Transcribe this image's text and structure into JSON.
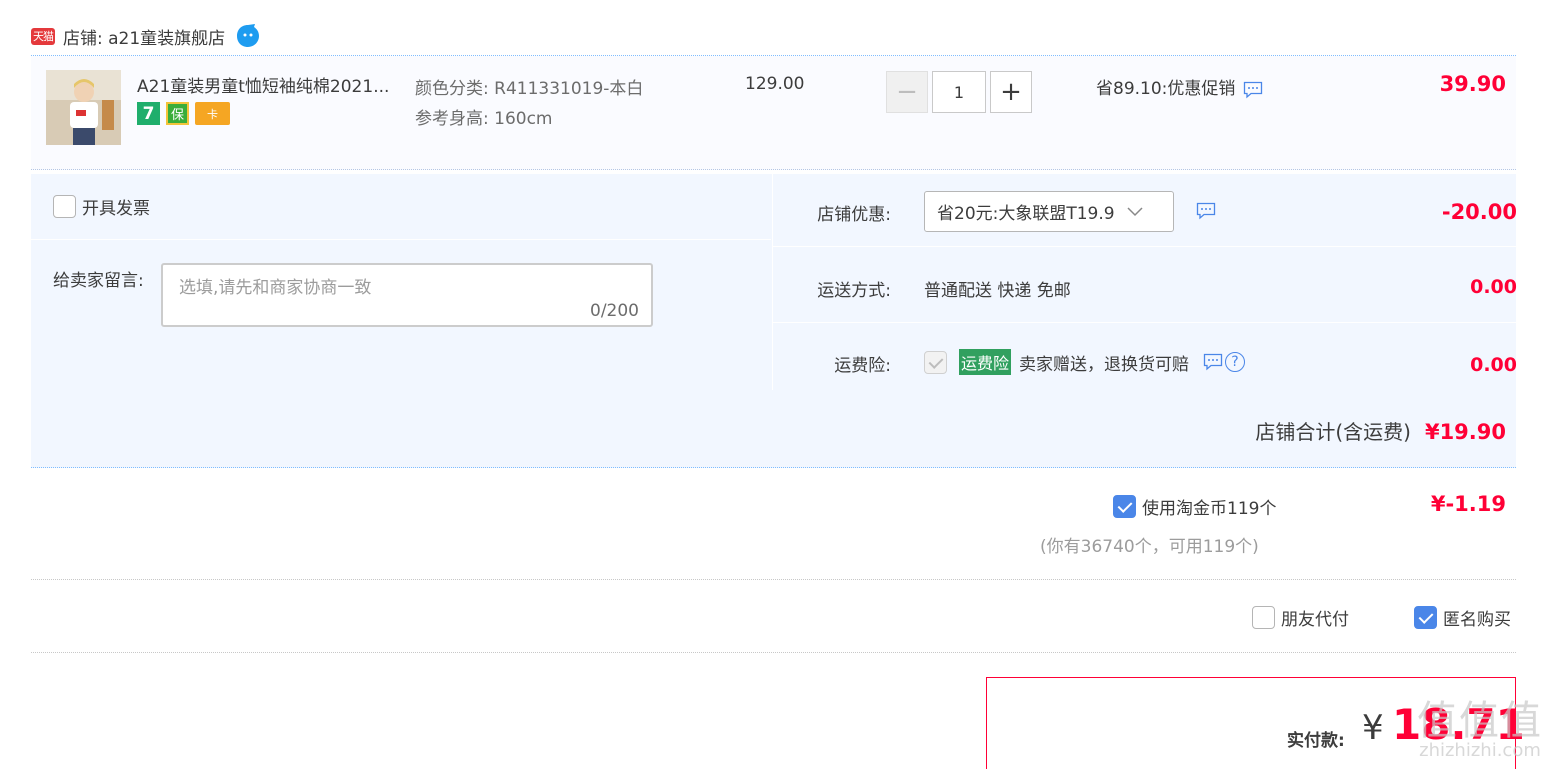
{
  "shop": {
    "badge": "天猫",
    "name": "店铺: a21童装旗舰店"
  },
  "item": {
    "title": "A21童装男童t恤短袖纯棉2021...",
    "service_icons": [
      "7",
      "保",
      "卡"
    ],
    "sku_color_label": "颜色分类:",
    "sku_color_value": "R411331019-本白",
    "sku_height_label": "参考身高:",
    "sku_height_value": "160cm",
    "unit_price": "129.00",
    "qty_minus": "−",
    "qty_value": "1",
    "qty_plus": "+",
    "promo": "省89.10:优惠促销",
    "subtotal": "39.90"
  },
  "invoice": {
    "label": "开具发票"
  },
  "message": {
    "label": "给卖家留言:",
    "placeholder": "选填,请先和商家协商一致",
    "count": "0/200"
  },
  "coupon": {
    "label": "店铺优惠:",
    "selected": "省20元:大象联盟T19.9",
    "amount": "-20.00"
  },
  "shipping": {
    "label": "运送方式:",
    "value": "普通配送 快递 免邮",
    "amount": "0.00"
  },
  "insurance": {
    "label": "运费险:",
    "tag": "运费险",
    "text": "卖家赠送，退换货可赔",
    "help": "?",
    "amount": "0.00"
  },
  "shop_total": {
    "label": "店铺合计(含运费)",
    "amount": "¥19.90"
  },
  "coins": {
    "label": "使用淘金币119个",
    "amount": "¥-1.19",
    "sub": "(你有36740个，可用119个)"
  },
  "options": {
    "friend_pay": "朋友代付",
    "anonymous": "匿名购买"
  },
  "payment": {
    "label": "实付款:",
    "currency": "¥",
    "amount": "18.71"
  },
  "watermark": {
    "line1": "值值值",
    "line2": "zhizhizhi.com"
  },
  "colors": {
    "accent_red": "#ff0036",
    "panel_bg": "#f2f7ff",
    "check_blue": "#4a86e8",
    "insurance_green": "#31a05f"
  }
}
